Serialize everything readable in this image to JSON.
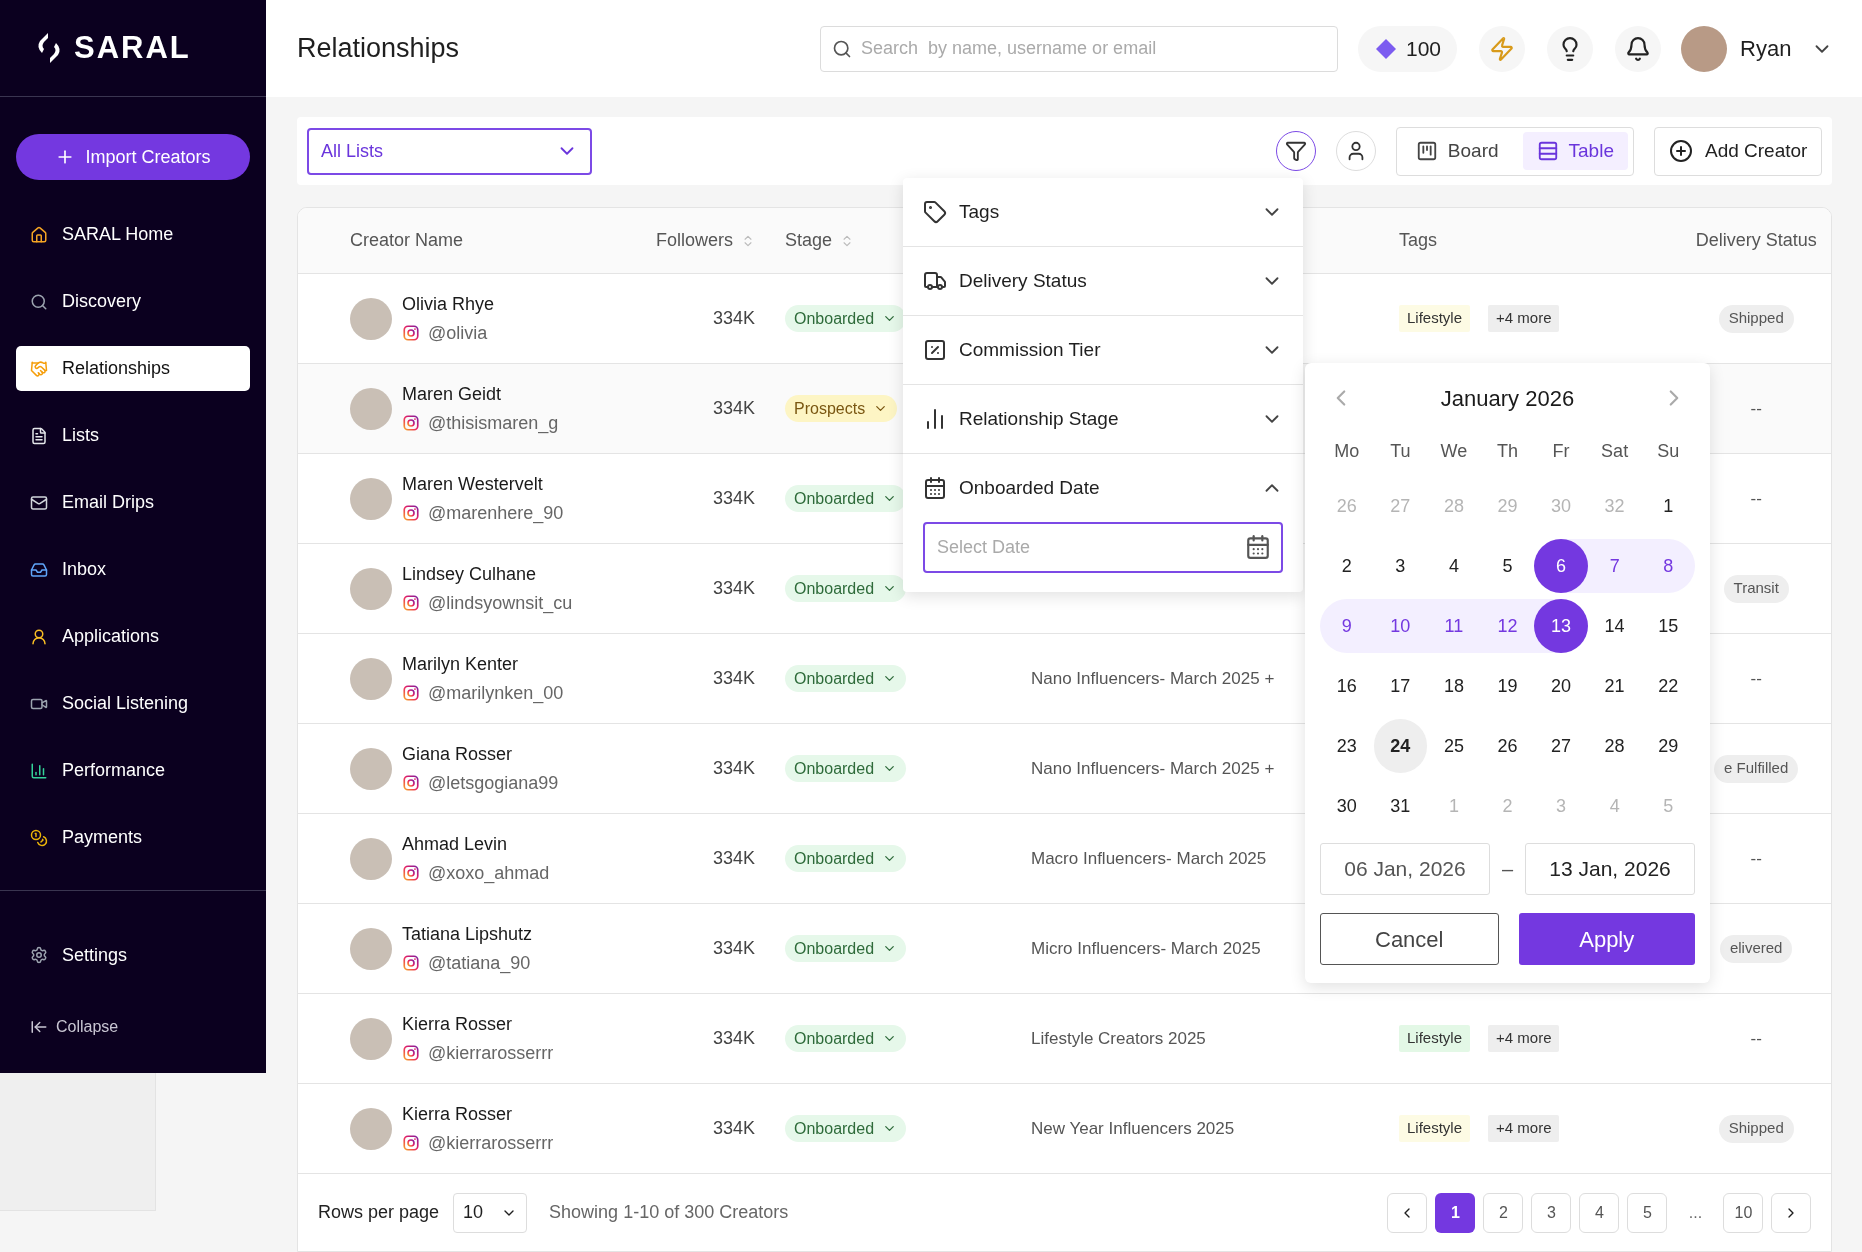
{
  "sidebar": {
    "logo": "SARAL",
    "import_button": "Import Creators",
    "items": [
      {
        "label": "SARAL Home",
        "selected": false
      },
      {
        "label": "Discovery",
        "selected": false
      },
      {
        "label": "Relationships",
        "selected": true
      },
      {
        "label": "Lists",
        "selected": false
      },
      {
        "label": "Email Drips",
        "selected": false
      },
      {
        "label": "Inbox",
        "selected": false
      },
      {
        "label": "Applications",
        "selected": false
      },
      {
        "label": "Social Listening",
        "selected": false
      },
      {
        "label": "Performance",
        "selected": false
      },
      {
        "label": "Payments",
        "selected": false
      }
    ],
    "settings": "Settings",
    "collapse": "Collapse"
  },
  "header": {
    "title": "Relationships",
    "search": {
      "placeholder": "Search  by name, username or email"
    },
    "credits": "100",
    "user": "Ryan"
  },
  "toolbar": {
    "list_select": "All Lists",
    "filter_active": true,
    "views": [
      {
        "label": "Board",
        "selected": false
      },
      {
        "label": "Table",
        "selected": true
      }
    ],
    "add_button": "Add Creator"
  },
  "table": {
    "columns": [
      {
        "label": "Creator Name",
        "sortable": false
      },
      {
        "label": "Followers",
        "sortable": true
      },
      {
        "label": "Stage",
        "sortable": true
      },
      {
        "label": "Tags",
        "sortable": false
      },
      {
        "label": "Delivery Status",
        "sortable": false
      }
    ],
    "rows": [
      {
        "name": "Olivia Rhye",
        "handle": "@olivia",
        "followers": "334K",
        "stage": {
          "label": "Onboarded",
          "kind": "onboarded"
        },
        "tags": [
          {
            "label": "Lifestyle",
            "color": "#fdfbe4"
          },
          {
            "label": "+4 more",
            "color": "#eeeeee"
          }
        ],
        "delivery": {
          "label": "Shipped",
          "kind": "pill"
        }
      },
      {
        "name": "Maren Geidt",
        "handle": "@thisismaren_g",
        "followers": "334K",
        "stage": {
          "label": "Prospects",
          "kind": "prospects"
        },
        "delivery": {
          "label": "--",
          "kind": "plain"
        }
      },
      {
        "name": "Maren Westervelt",
        "handle": "@marenhere_90",
        "followers": "334K",
        "stage": {
          "label": "Onboarded",
          "kind": "onboarded"
        },
        "delivery": {
          "label": "--",
          "kind": "plain"
        }
      },
      {
        "name": "Lindsey Culhane",
        "handle": "@lindsyownsit_cu",
        "followers": "334K",
        "stage": {
          "label": "Onboarded",
          "kind": "onboarded"
        },
        "delivery": {
          "label": "Transit",
          "kind": "pill"
        }
      },
      {
        "name": "Marilyn Kenter",
        "handle": "@marilynken_00",
        "followers": "334K",
        "stage": {
          "label": "Onboarded",
          "kind": "onboarded"
        },
        "list": "Nano Influencers- March 2025 +",
        "delivery": {
          "label": "--",
          "kind": "plain"
        }
      },
      {
        "name": "Giana Rosser",
        "handle": "@letsgogiana99",
        "followers": "334K",
        "stage": {
          "label": "Onboarded",
          "kind": "onboarded"
        },
        "list": "Nano Influencers- March 2025 +",
        "delivery": {
          "label": "e Fulfilled",
          "kind": "pill"
        }
      },
      {
        "name": "Ahmad Levin",
        "handle": "@xoxo_ahmad",
        "followers": "334K",
        "stage": {
          "label": "Onboarded",
          "kind": "onboarded"
        },
        "list": "Macro Influencers- March 2025",
        "delivery": {
          "label": "--",
          "kind": "plain"
        }
      },
      {
        "name": "Tatiana Lipshutz",
        "handle": "@tatiana_90",
        "followers": "334K",
        "stage": {
          "label": "Onboarded",
          "kind": "onboarded"
        },
        "list": "Micro Influencers- March 2025",
        "delivery": {
          "label": "elivered",
          "kind": "pill"
        }
      },
      {
        "name": "Kierra Rosser",
        "handle": "@kierrarosserrr",
        "followers": "334K",
        "stage": {
          "label": "Onboarded",
          "kind": "onboarded"
        },
        "list": "Lifestyle Creators 2025",
        "tags": [
          {
            "label": "Lifestyle",
            "color": "#e3f8e6"
          },
          {
            "label": "+4 more",
            "color": "#eeeeee"
          }
        ],
        "delivery": {
          "label": "--",
          "kind": "plain"
        }
      },
      {
        "name": "Kierra Rosser",
        "handle": "@kierrarosserrr",
        "followers": "334K",
        "stage": {
          "label": "Onboarded",
          "kind": "onboarded"
        },
        "list": "New Year Influencers 2025",
        "tags": [
          {
            "label": "Lifestyle",
            "color": "#fdfbe4"
          },
          {
            "label": "+4 more",
            "color": "#eeeeee"
          }
        ],
        "delivery": {
          "label": "Shipped",
          "kind": "pill"
        }
      }
    ]
  },
  "pagination": {
    "rows_label": "Rows per page",
    "rows_value": "10",
    "summary": "Showing 1-10 of 300 Creators",
    "pages": [
      {
        "label": "1",
        "kind": "page",
        "selected": true
      },
      {
        "label": "2",
        "kind": "page",
        "selected": false
      },
      {
        "label": "3",
        "kind": "page",
        "selected": false
      },
      {
        "label": "4",
        "kind": "page",
        "selected": false
      },
      {
        "label": "5",
        "kind": "page",
        "selected": false
      },
      {
        "label": "...",
        "kind": "ellipsis"
      },
      {
        "label": "10",
        "kind": "page",
        "selected": false
      }
    ]
  },
  "filter_panel": {
    "sections": [
      {
        "label": "Tags",
        "expanded": false
      },
      {
        "label": "Delivery Status",
        "expanded": false
      },
      {
        "label": "Commission Tier",
        "expanded": false
      },
      {
        "label": "Relationship Stage",
        "expanded": false
      },
      {
        "label": "Onboarded Date",
        "expanded": true,
        "field": {
          "placeholder": "Select Date"
        }
      }
    ]
  },
  "calendar": {
    "month": "January 2026",
    "weekdays": [
      "Mo",
      "Tu",
      "We",
      "Th",
      "Fr",
      "Sat",
      "Su"
    ],
    "days": [
      {
        "day": "26",
        "outside": true,
        "selected": false,
        "in_range": false,
        "today": false
      },
      {
        "day": "27",
        "outside": true,
        "selected": false,
        "in_range": false,
        "today": false
      },
      {
        "day": "28",
        "outside": true,
        "selected": false,
        "in_range": false,
        "today": false
      },
      {
        "day": "29",
        "outside": true,
        "selected": false,
        "in_range": false,
        "today": false
      },
      {
        "day": "30",
        "outside": true,
        "selected": false,
        "in_range": false,
        "today": false
      },
      {
        "day": "32",
        "outside": true,
        "selected": false,
        "in_range": false,
        "today": false
      },
      {
        "day": "1",
        "outside": false,
        "selected": false,
        "in_range": false,
        "today": false
      },
      {
        "day": "2",
        "outside": false,
        "selected": false,
        "in_range": false,
        "today": false
      },
      {
        "day": "3",
        "outside": false,
        "selected": false,
        "in_range": false,
        "today": false
      },
      {
        "day": "4",
        "outside": false,
        "selected": false,
        "in_range": false,
        "today": false
      },
      {
        "day": "5",
        "outside": false,
        "selected": false,
        "in_range": false,
        "today": false
      },
      {
        "day": "6",
        "outside": false,
        "selected": true,
        "in_range": false,
        "today": false
      },
      {
        "day": "7",
        "outside": false,
        "selected": false,
        "in_range": true,
        "today": false
      },
      {
        "day": "8",
        "outside": false,
        "selected": false,
        "in_range": true,
        "today": false
      },
      {
        "day": "9",
        "outside": false,
        "selected": false,
        "in_range": true,
        "today": false
      },
      {
        "day": "10",
        "outside": false,
        "selected": false,
        "in_range": true,
        "today": false
      },
      {
        "day": "11",
        "outside": false,
        "selected": false,
        "in_range": true,
        "today": false
      },
      {
        "day": "12",
        "outside": false,
        "selected": false,
        "in_range": true,
        "today": false
      },
      {
        "day": "13",
        "outside": false,
        "selected": true,
        "in_range": false,
        "today": false
      },
      {
        "day": "14",
        "outside": false,
        "selected": false,
        "in_range": false,
        "today": false
      },
      {
        "day": "15",
        "outside": false,
        "selected": false,
        "in_range": false,
        "today": false
      },
      {
        "day": "16",
        "outside": false,
        "selected": false,
        "in_range": false,
        "today": false
      },
      {
        "day": "17",
        "outside": false,
        "selected": false,
        "in_range": false,
        "today": false
      },
      {
        "day": "18",
        "outside": false,
        "selected": false,
        "in_range": false,
        "today": false
      },
      {
        "day": "19",
        "outside": false,
        "selected": false,
        "in_range": false,
        "today": false
      },
      {
        "day": "20",
        "outside": false,
        "selected": false,
        "in_range": false,
        "today": false
      },
      {
        "day": "21",
        "outside": false,
        "selected": false,
        "in_range": false,
        "today": false
      },
      {
        "day": "22",
        "outside": false,
        "selected": false,
        "in_range": false,
        "today": false
      },
      {
        "day": "23",
        "outside": false,
        "selected": false,
        "in_range": false,
        "today": false
      },
      {
        "day": "24",
        "outside": false,
        "selected": false,
        "in_range": false,
        "today": true
      },
      {
        "day": "25",
        "outside": false,
        "selected": false,
        "in_range": false,
        "today": false
      },
      {
        "day": "26",
        "outside": false,
        "selected": false,
        "in_range": false,
        "today": false
      },
      {
        "day": "27",
        "outside": false,
        "selected": false,
        "in_range": false,
        "today": false
      },
      {
        "day": "28",
        "outside": false,
        "selected": false,
        "in_range": false,
        "today": false
      },
      {
        "day": "29",
        "outside": false,
        "selected": false,
        "in_range": false,
        "today": false
      },
      {
        "day": "30",
        "outside": false,
        "selected": false,
        "in_range": false,
        "today": false
      },
      {
        "day": "31",
        "outside": false,
        "selected": false,
        "in_range": false,
        "today": false
      },
      {
        "day": "1",
        "outside": true,
        "selected": false,
        "in_range": false,
        "today": false
      },
      {
        "day": "2",
        "outside": true,
        "selected": false,
        "in_range": false,
        "today": false
      },
      {
        "day": "3",
        "outside": true,
        "selected": false,
        "in_range": false,
        "today": false
      },
      {
        "day": "4",
        "outside": true,
        "selected": false,
        "in_range": false,
        "today": false
      },
      {
        "day": "5",
        "outside": true,
        "selected": false,
        "in_range": false,
        "today": false
      }
    ],
    "start": "06 Jan, 2026",
    "separator": "–",
    "end": "13 Jan, 2026",
    "cancel": "Cancel",
    "apply": "Apply"
  }
}
